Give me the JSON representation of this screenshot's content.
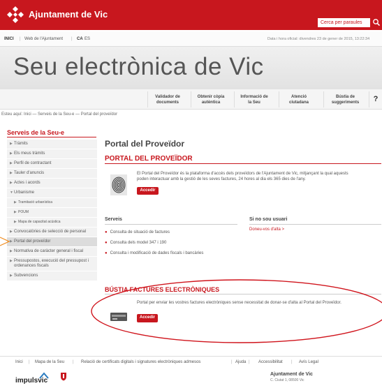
{
  "header": {
    "brand": "Ajuntament de Vic",
    "search_placeholder": "Cerca per paraules"
  },
  "nav": {
    "items": [
      "INICI",
      "Web de l'Ajuntament",
      "CA",
      "ES"
    ],
    "date": "Data i hora oficial: divendres 23 de gener de 2015, 13:22:34"
  },
  "banner": {
    "title": "Seu electrònica de Vic"
  },
  "toolbar": {
    "items": [
      [
        "Validador de",
        "documents"
      ],
      [
        "Obtenir còpia",
        "autèntica"
      ],
      [
        "Informació de",
        "la Seu"
      ],
      [
        "Atenció",
        "ciutadana"
      ],
      [
        "Bústia de",
        "suggeriments"
      ]
    ],
    "help": "?"
  },
  "breadcrumb": "Esteu aquí: Inici — Serveis de la Seu-e — Portal del proveïdor",
  "sidebar": {
    "title": "Serveis de la Seu-e",
    "items": [
      "Tràmits",
      "Els meus tràmits",
      "Perfil de contractant",
      "Tauler d'anuncis",
      "Actes i acords",
      "Urbanisme",
      "Tramitació urbanística",
      "POUM",
      "Mapa de capacitat acústica",
      "Convocatòries de selecció de personal",
      "Portal del proveïdor",
      "Normativa de caràcter general i fiscal",
      "Pressupostos, execució del pressupost i ordenances fiscals",
      "Subvencions"
    ]
  },
  "main": {
    "title": "Portal del Proveïdor",
    "section_title": "PORTAL DEL PROVEÏDOR",
    "intro_line1": "El Portal del Proveïdor és la plataforma d'accés dels proveïdors de l'Ajuntament de Vic, mitjançant la qual aquests",
    "intro_line2": "poden interactuar amb la gestió de les seves factures, 24 hores al dia els 365 dies de l'any.",
    "access_button": "Accedir",
    "services_title": "Serveis",
    "services": [
      "Consulta de situació de factures",
      "Consulta dels model 347 i 190",
      "Consulta i modificació de dades fiscals i bancàries"
    ],
    "not_user_title": "Si no sou usuari",
    "signup_link": "Doneu-vos d'alta >",
    "section2_title": "BÚSTIA FACTURES ELECTRÒNIQUES",
    "section2_text": "Portal per enviar les vostres factures electròniques sense necessitat de donar-se d'alta al Portal del Proveïdor.",
    "access_button2": "Accedir"
  },
  "footer": {
    "links": [
      "Inici",
      "Mapa de la Seu",
      "Relació de certificats digitals i signatures electròniques admesos",
      "Ajuda",
      "Accessibilitat",
      "Avís Legal"
    ],
    "brand": "impulsvic",
    "address_name": "Ajuntament de Vic",
    "address_line": "C. Ciutat 1, 08500 Vic"
  },
  "colors": {
    "accent": "#c8171e",
    "highlight_oval": "#d0141c"
  }
}
